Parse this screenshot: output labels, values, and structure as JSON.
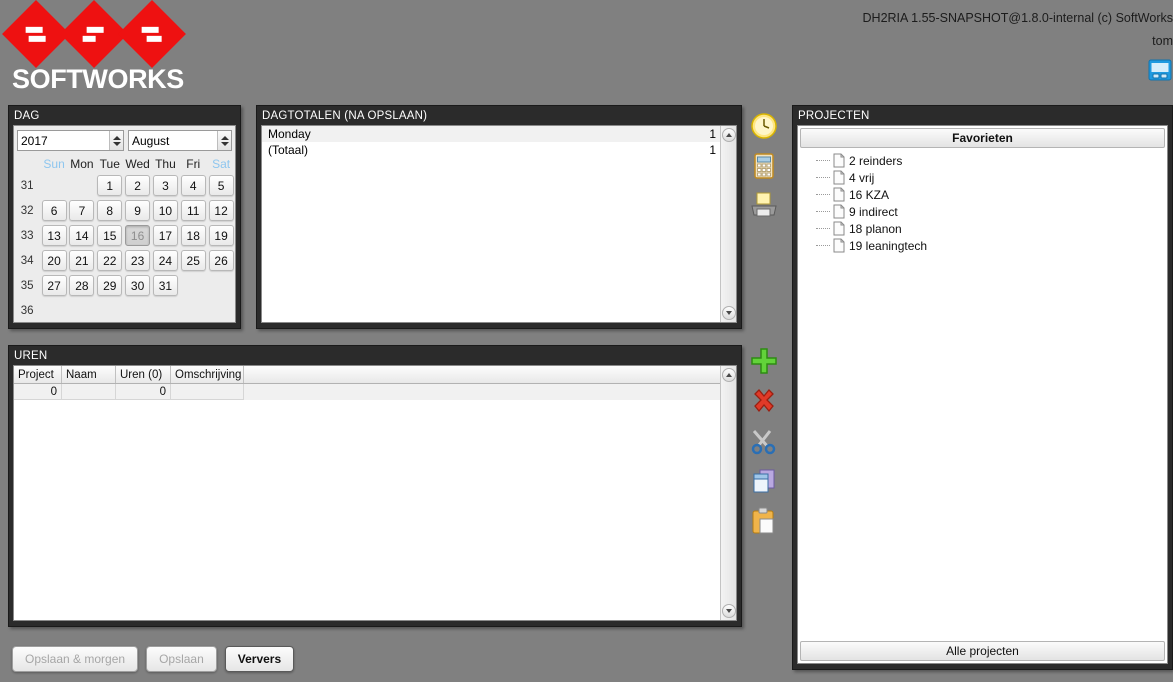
{
  "header": {
    "logo_text": "SOFTWORKS",
    "version": "DH2RIA 1.55-SNAPSHOT@1.8.0-internal (c) SoftWorks",
    "user": "tom",
    "window_icon": "window-icon"
  },
  "dag": {
    "title": "DAG",
    "year": "2017",
    "month": "August",
    "weekday_headers": [
      "Sun",
      "Mon",
      "Tue",
      "Wed",
      "Thu",
      "Fri",
      "Sat"
    ],
    "week_numbers": [
      "31",
      "32",
      "33",
      "34",
      "35",
      "36"
    ],
    "weeks": [
      [
        "",
        "",
        "1",
        "2",
        "3",
        "4",
        "5"
      ],
      [
        "6",
        "7",
        "8",
        "9",
        "10",
        "11",
        "12"
      ],
      [
        "13",
        "14",
        "15",
        "16",
        "17",
        "18",
        "19"
      ],
      [
        "20",
        "21",
        "22",
        "23",
        "24",
        "25",
        "26"
      ],
      [
        "27",
        "28",
        "29",
        "30",
        "31",
        "",
        ""
      ],
      [
        "",
        "",
        "",
        "",
        "",
        "",
        ""
      ]
    ],
    "selected_day": "16"
  },
  "dagtotalen": {
    "title": "DAGTOTALEN (NA OPSLAAN)",
    "rows": [
      {
        "label": "Monday",
        "value": "1"
      },
      {
        "label": "(Totaal)",
        "value": "1"
      }
    ]
  },
  "rail_top": [
    {
      "name": "clock-icon"
    },
    {
      "name": "calculator-icon"
    },
    {
      "name": "printer-icon"
    }
  ],
  "rail_bottom": [
    {
      "name": "add-icon"
    },
    {
      "name": "delete-icon"
    },
    {
      "name": "cut-icon"
    },
    {
      "name": "copy-icon"
    },
    {
      "name": "paste-icon"
    }
  ],
  "uren": {
    "title": "UREN",
    "columns": [
      "Project",
      "Naam",
      "Uren (0)",
      "Omschrijving"
    ],
    "rows": [
      {
        "project": "0",
        "naam": "",
        "uren": "0",
        "omschrijving": ""
      }
    ]
  },
  "projecten": {
    "title": "PROJECTEN",
    "favorites_label": "Favorieten",
    "all_label": "Alle projecten",
    "items": [
      {
        "label": "2 reinders"
      },
      {
        "label": "4 vrij"
      },
      {
        "label": "16 KZA"
      },
      {
        "label": "9 indirect"
      },
      {
        "label": "18 planon"
      },
      {
        "label": "19 leaningtech"
      }
    ]
  },
  "buttons": {
    "save_tomorrow": "Opslaan & morgen",
    "save": "Opslaan",
    "refresh": "Ververs"
  },
  "colors": {
    "background": "#808080",
    "panel_title_bar": "#2b2b2b",
    "brand_red": "#ee1111",
    "weekend_header": "#8ec6ef"
  }
}
